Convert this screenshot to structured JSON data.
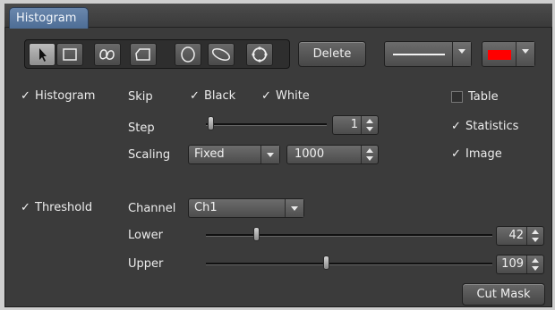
{
  "tab": {
    "label": "Histogram"
  },
  "toolbar": {
    "delete_label": "Delete",
    "tools": [
      "pointer-icon",
      "rectangle-icon",
      "freehand-icon",
      "polygon-icon",
      "ellipse-icon",
      "closed-curve-icon",
      "circle-rotate-icon"
    ],
    "line_style": "solid",
    "color": "#ff0000"
  },
  "histogram": {
    "label": "Histogram",
    "checked": true,
    "skip_label": "Skip",
    "black_label": "Black",
    "black_checked": true,
    "white_label": "White",
    "white_checked": true,
    "step_label": "Step",
    "step_value": "1",
    "scaling_label": "Scaling",
    "scaling_value": "Fixed",
    "scaling_number": "1000"
  },
  "options": {
    "table_label": "Table",
    "table_checked": false,
    "statistics_label": "Statistics",
    "statistics_checked": true,
    "image_label": "Image",
    "image_checked": true
  },
  "threshold": {
    "label": "Threshold",
    "checked": true,
    "channel_label": "Channel",
    "channel_value": "Ch1",
    "lower_label": "Lower",
    "lower_value": "42",
    "upper_label": "Upper",
    "upper_value": "109"
  },
  "cut_mask_label": "Cut Mask"
}
